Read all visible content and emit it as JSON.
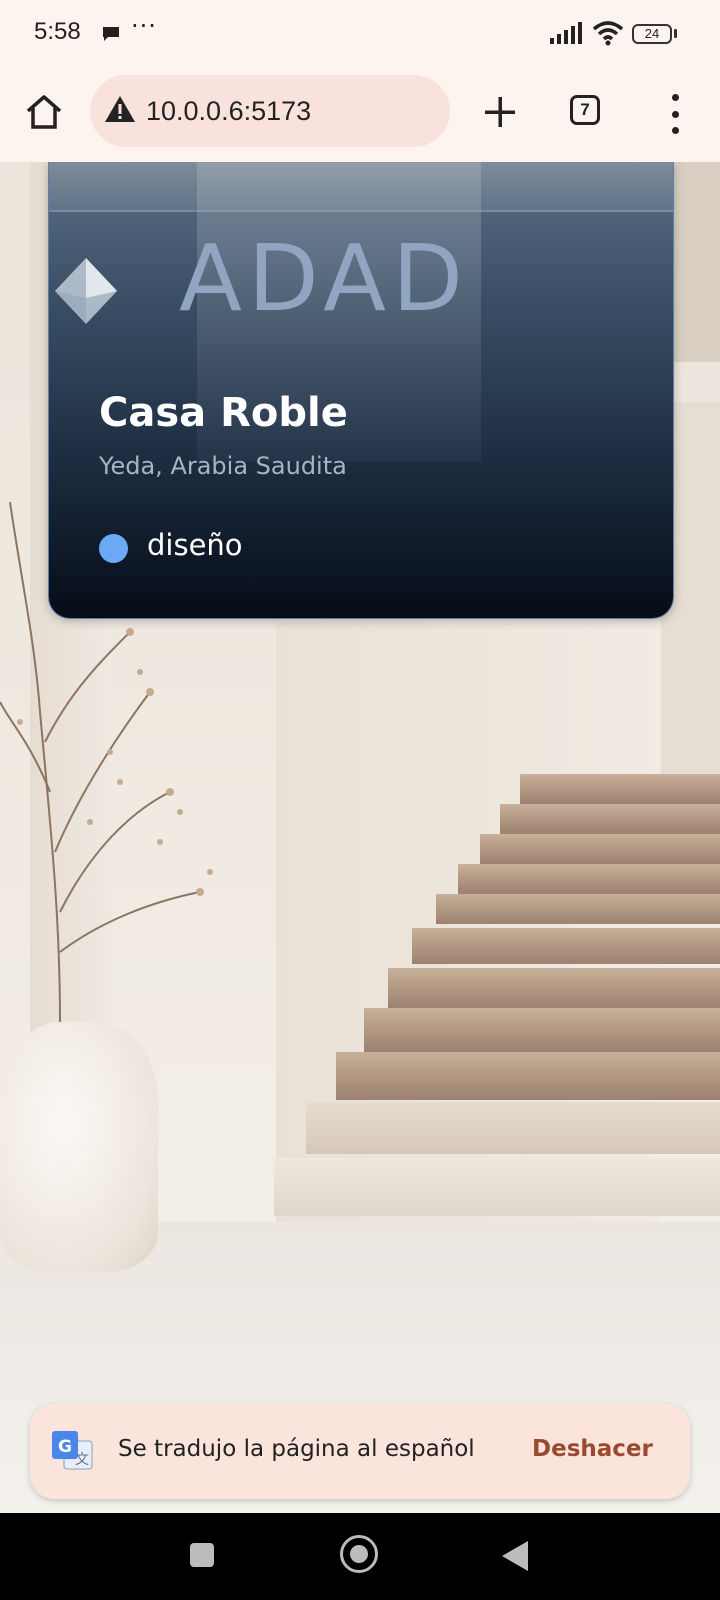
{
  "status_bar": {
    "time": "5:58",
    "more": "···",
    "battery": "24"
  },
  "toolbar": {
    "url": "10.0.0.6:5173",
    "tab_count": "7"
  },
  "card": {
    "logo_text": "ADAD",
    "title": "Casa Roble",
    "subtitle": "Yeda, Arabia Saudita",
    "tag": "diseño",
    "tag_color": "#6ba8f5"
  },
  "toast": {
    "message": "Se tradujo la página al español",
    "action": "Deshacer"
  }
}
